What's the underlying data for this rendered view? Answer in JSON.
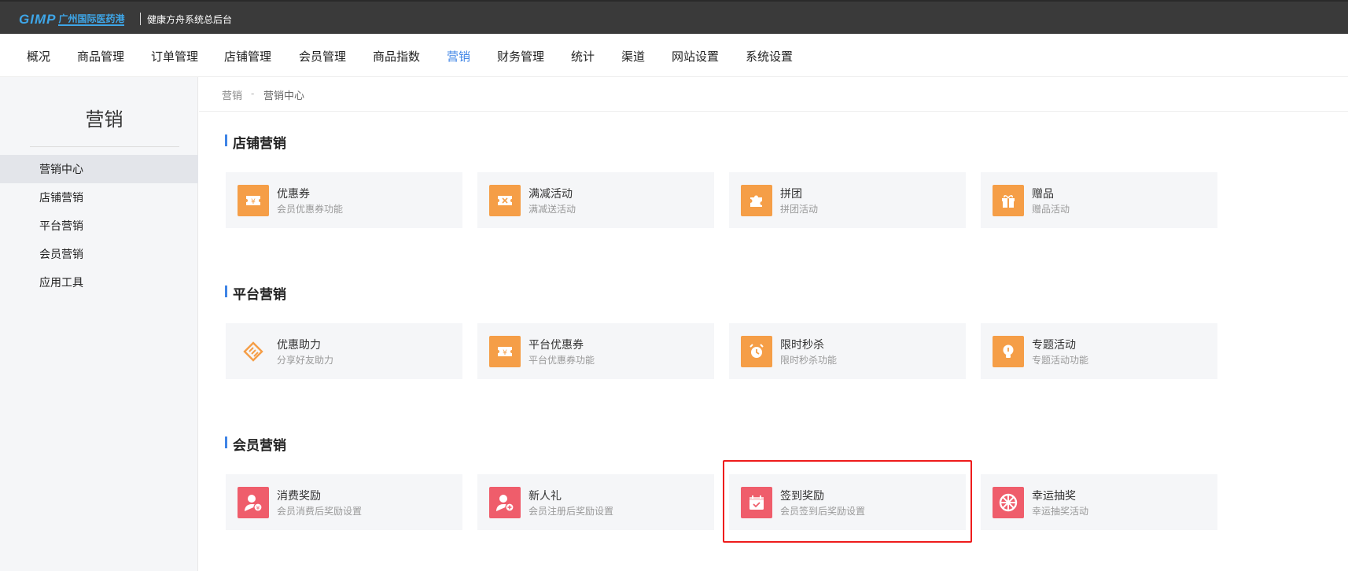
{
  "header": {
    "logo_text": "GIMP",
    "logo_cn": "广州国际医药港",
    "system_title": "健康方舟系统总后台"
  },
  "nav": {
    "items": [
      "概况",
      "商品管理",
      "订单管理",
      "店铺管理",
      "会员管理",
      "商品指数",
      "营销",
      "财务管理",
      "统计",
      "渠道",
      "网站设置",
      "系统设置"
    ],
    "active": "营销"
  },
  "sidebar": {
    "title": "营销",
    "items": [
      "营销中心",
      "店铺营销",
      "平台营销",
      "会员营销",
      "应用工具"
    ],
    "active": "营销中心"
  },
  "breadcrumb": {
    "parent": "营销",
    "separator": "-",
    "current": "营销中心"
  },
  "sections": [
    {
      "title": "店铺营销",
      "cards": [
        {
          "name": "优惠券",
          "desc": "会员优惠券功能",
          "icon": "ticket-icon"
        },
        {
          "name": "满减活动",
          "desc": "满减送活动",
          "icon": "ticket-icon"
        },
        {
          "name": "拼团",
          "desc": "拼团活动",
          "icon": "puzzle-icon"
        },
        {
          "name": "赠品",
          "desc": "赠品活动",
          "icon": "gift-icon"
        }
      ]
    },
    {
      "title": "平台营销",
      "cards": [
        {
          "name": "优惠助力",
          "desc": "分享好友助力",
          "icon": "tag-icon"
        },
        {
          "name": "平台优惠券",
          "desc": "平台优惠券功能",
          "icon": "ticket-icon"
        },
        {
          "name": "限时秒杀",
          "desc": "限时秒杀功能",
          "icon": "alarm-clock-icon"
        },
        {
          "name": "专题活动",
          "desc": "专题活动功能",
          "icon": "lightbulb-icon"
        }
      ]
    },
    {
      "title": "会员营销",
      "cards": [
        {
          "name": "消费奖励",
          "desc": "会员消费后奖励设置",
          "icon": "user-reward-icon"
        },
        {
          "name": "新人礼",
          "desc": "会员注册后奖励设置",
          "icon": "user-add-icon"
        },
        {
          "name": "签到奖励",
          "desc": "会员签到后奖励设置",
          "icon": "calendar-check-icon"
        },
        {
          "name": "幸运抽奖",
          "desc": "幸运抽奖活动",
          "icon": "wheel-icon"
        }
      ]
    }
  ],
  "colors": {
    "accent": "#3f84e6",
    "icon_orange": "#f59e47",
    "icon_red": "#ef5d6b",
    "highlight": "#ee1c1c"
  }
}
